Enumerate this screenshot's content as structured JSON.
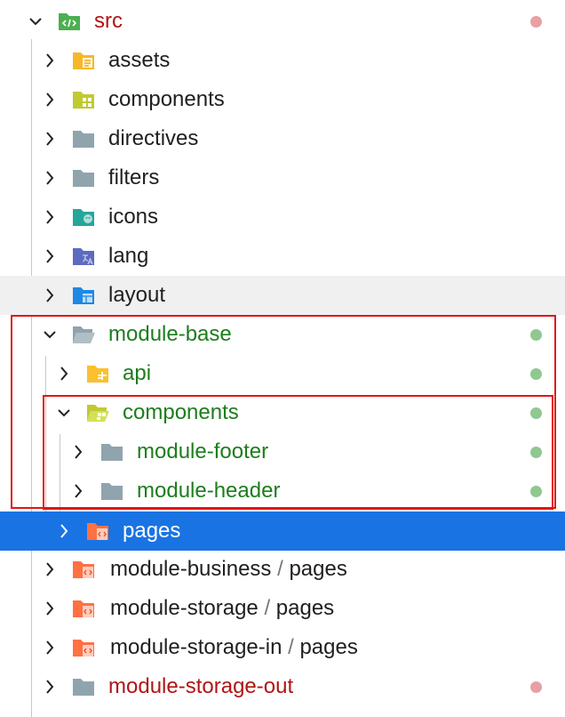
{
  "tree": {
    "root": {
      "label": "src",
      "icon": "src-folder-icon",
      "color": "#b01515",
      "status": "#e8a0a3"
    },
    "rows": [
      {
        "label": "assets",
        "icon": "assets-folder-icon"
      },
      {
        "label": "components",
        "icon": "components-folder-icon"
      },
      {
        "label": "directives",
        "icon": "folder-icon"
      },
      {
        "label": "filters",
        "icon": "folder-icon"
      },
      {
        "label": "icons",
        "icon": "icons-folder-icon"
      },
      {
        "label": "lang",
        "icon": "lang-folder-icon"
      },
      {
        "label": "layout",
        "icon": "layout-folder-icon"
      },
      {
        "label": "module-base",
        "icon": "folder-open-icon"
      },
      {
        "label": "api",
        "icon": "api-folder-icon"
      },
      {
        "label": "components",
        "icon": "components-folder-open-icon"
      },
      {
        "label": "module-footer",
        "icon": "folder-icon"
      },
      {
        "label": "module-header",
        "icon": "folder-icon"
      },
      {
        "label": "pages",
        "icon": "pages-folder-icon"
      },
      {
        "label": "module-business",
        "suffix": "pages",
        "icon": "pages-folder-icon"
      },
      {
        "label": "module-storage",
        "suffix": "pages",
        "icon": "pages-folder-icon"
      },
      {
        "label": "module-storage-in",
        "suffix": "pages",
        "icon": "pages-folder-icon"
      },
      {
        "label": "module-storage-out",
        "icon": "folder-icon"
      }
    ],
    "separator": "/"
  },
  "colors": {
    "modified_dot": "#90c890",
    "error_dot": "#e8a0a3",
    "selection": "#1a73e3"
  }
}
